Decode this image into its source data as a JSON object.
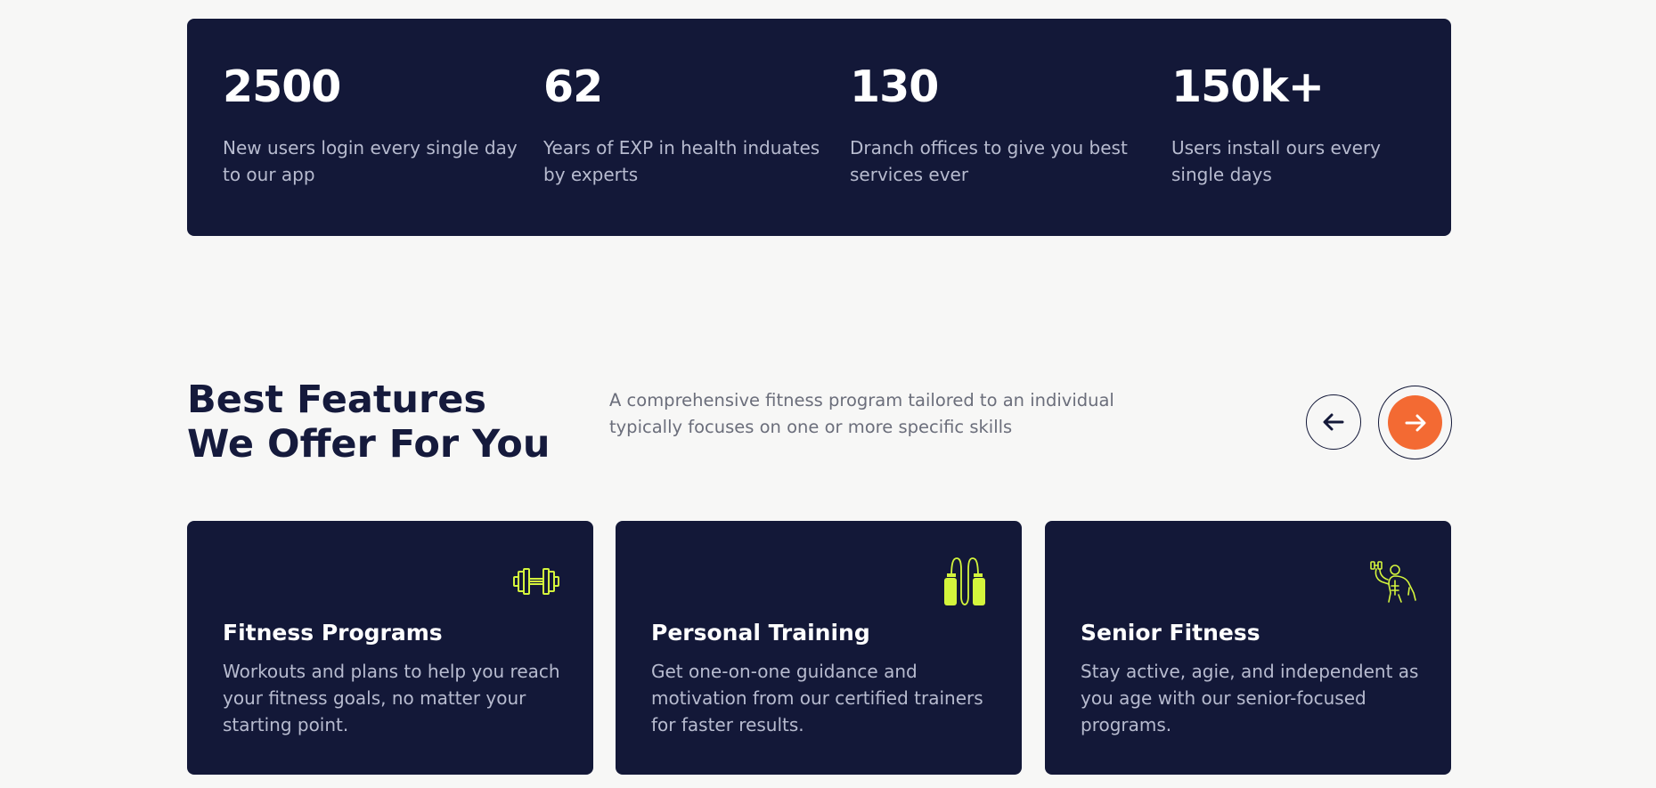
{
  "stats": [
    {
      "value": "2500",
      "description": "New users login every single day to our app"
    },
    {
      "value": "62",
      "description": "Years of EXP in health induates by experts"
    },
    {
      "value": "130",
      "description": "Dranch offices to give you best services ever"
    },
    {
      "value": "150k+",
      "description": "Users install ours every single days"
    }
  ],
  "features": {
    "heading": "Best Features\nWe Offer For You",
    "intro": "A comprehensive fitness program tailored to an individual typically focuses on one or more specific skills",
    "prev_icon": "arrow-left-icon",
    "next_icon": "arrow-right-icon",
    "cards": [
      {
        "icon": "dumbbell-icon",
        "title": "Fitness Programs",
        "description": "Workouts and plans to help you reach your fitness goals, no matter your starting point."
      },
      {
        "icon": "jump-rope-icon",
        "title": "Personal Training",
        "description": "Get one-on-one guidance and motivation from our certified trainers for faster results."
      },
      {
        "icon": "bodybuilder-icon",
        "title": "Senior Fitness",
        "description": "Stay active, agie, and independent as you age with our senior-focused programs."
      }
    ]
  },
  "colors": {
    "page_background": "#f7f7f6",
    "panel_navy": "#131838",
    "heading_navy": "#151a3c",
    "accent_orange": "#f36a33",
    "icon_lime": "#d4f53c",
    "muted_text": "#b7bbcf",
    "intro_text": "#6b6e7b"
  }
}
